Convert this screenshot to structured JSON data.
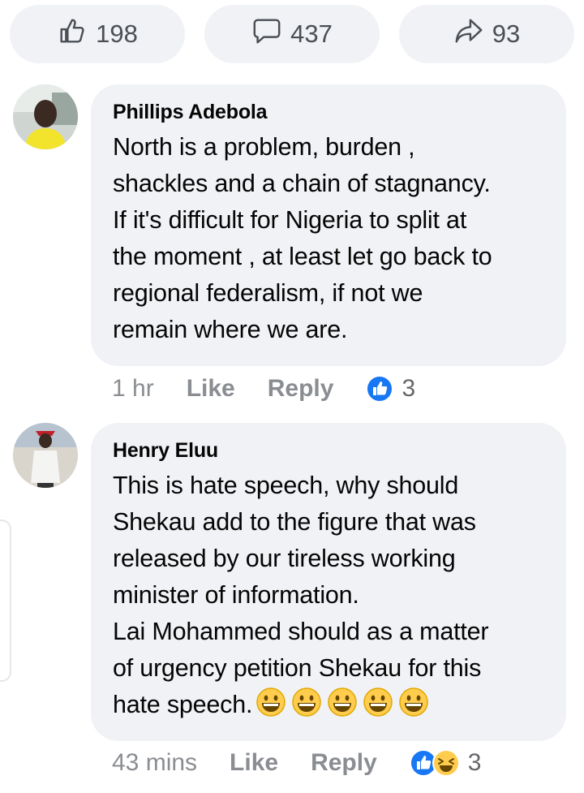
{
  "actions": {
    "like_count": "198",
    "comment_count": "437",
    "share_count": "93"
  },
  "comments": [
    {
      "author": "Phillips Adebola",
      "text": "North is a problem, burden ,\nshackles and a chain of stagnancy.\nIf it's difficult for Nigeria to split at\nthe moment , at least let go back to\nregional federalism, if not we\nremain where we are.",
      "time": "1 hr",
      "like_label": "Like",
      "reply_label": "Reply",
      "reaction_count": "3",
      "reaction_icons": [
        "like-reaction-icon"
      ]
    },
    {
      "author": "Henry Eluu",
      "text": "This is hate speech, why should\nShekau add to the figure that was\nreleased by our tireless working\nminister of information.\nLai Mohammed should as a matter\nof urgency petition Shekau for this\nhate speech.",
      "emojis": [
        "grinning-face-emoji",
        "grinning-face-emoji",
        "grinning-face-emoji",
        "grinning-face-emoji",
        "grinning-face-emoji"
      ],
      "time": "43 mins",
      "like_label": "Like",
      "reply_label": "Reply",
      "reaction_count": "3",
      "reaction_icons": [
        "like-reaction-icon",
        "haha-reaction-icon"
      ]
    }
  ],
  "colors": {
    "bubble": "#f0f2f5",
    "meta_text": "#8a8d91",
    "like_blue": "#1877f2",
    "emoji_yellow": "#ffcc4d"
  }
}
